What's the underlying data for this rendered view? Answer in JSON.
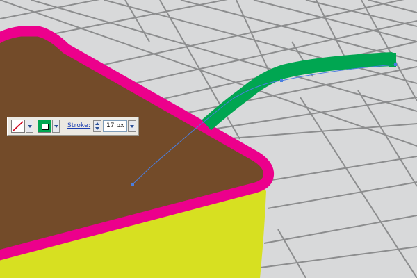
{
  "canvas": {
    "background": "#d8d9da",
    "grid_color": "#8c8d8e",
    "box_fill": "#734b29",
    "box_outline": "#ec008c",
    "box_side": "#d7e021",
    "path_stroke": "#00a651",
    "anchor_color": "#4a7ee0"
  },
  "control_panel": {
    "fill_swatch": "none",
    "stroke_swatch": "#00a651",
    "stroke_label": "Stroke:",
    "stroke_weight": "17 px"
  }
}
